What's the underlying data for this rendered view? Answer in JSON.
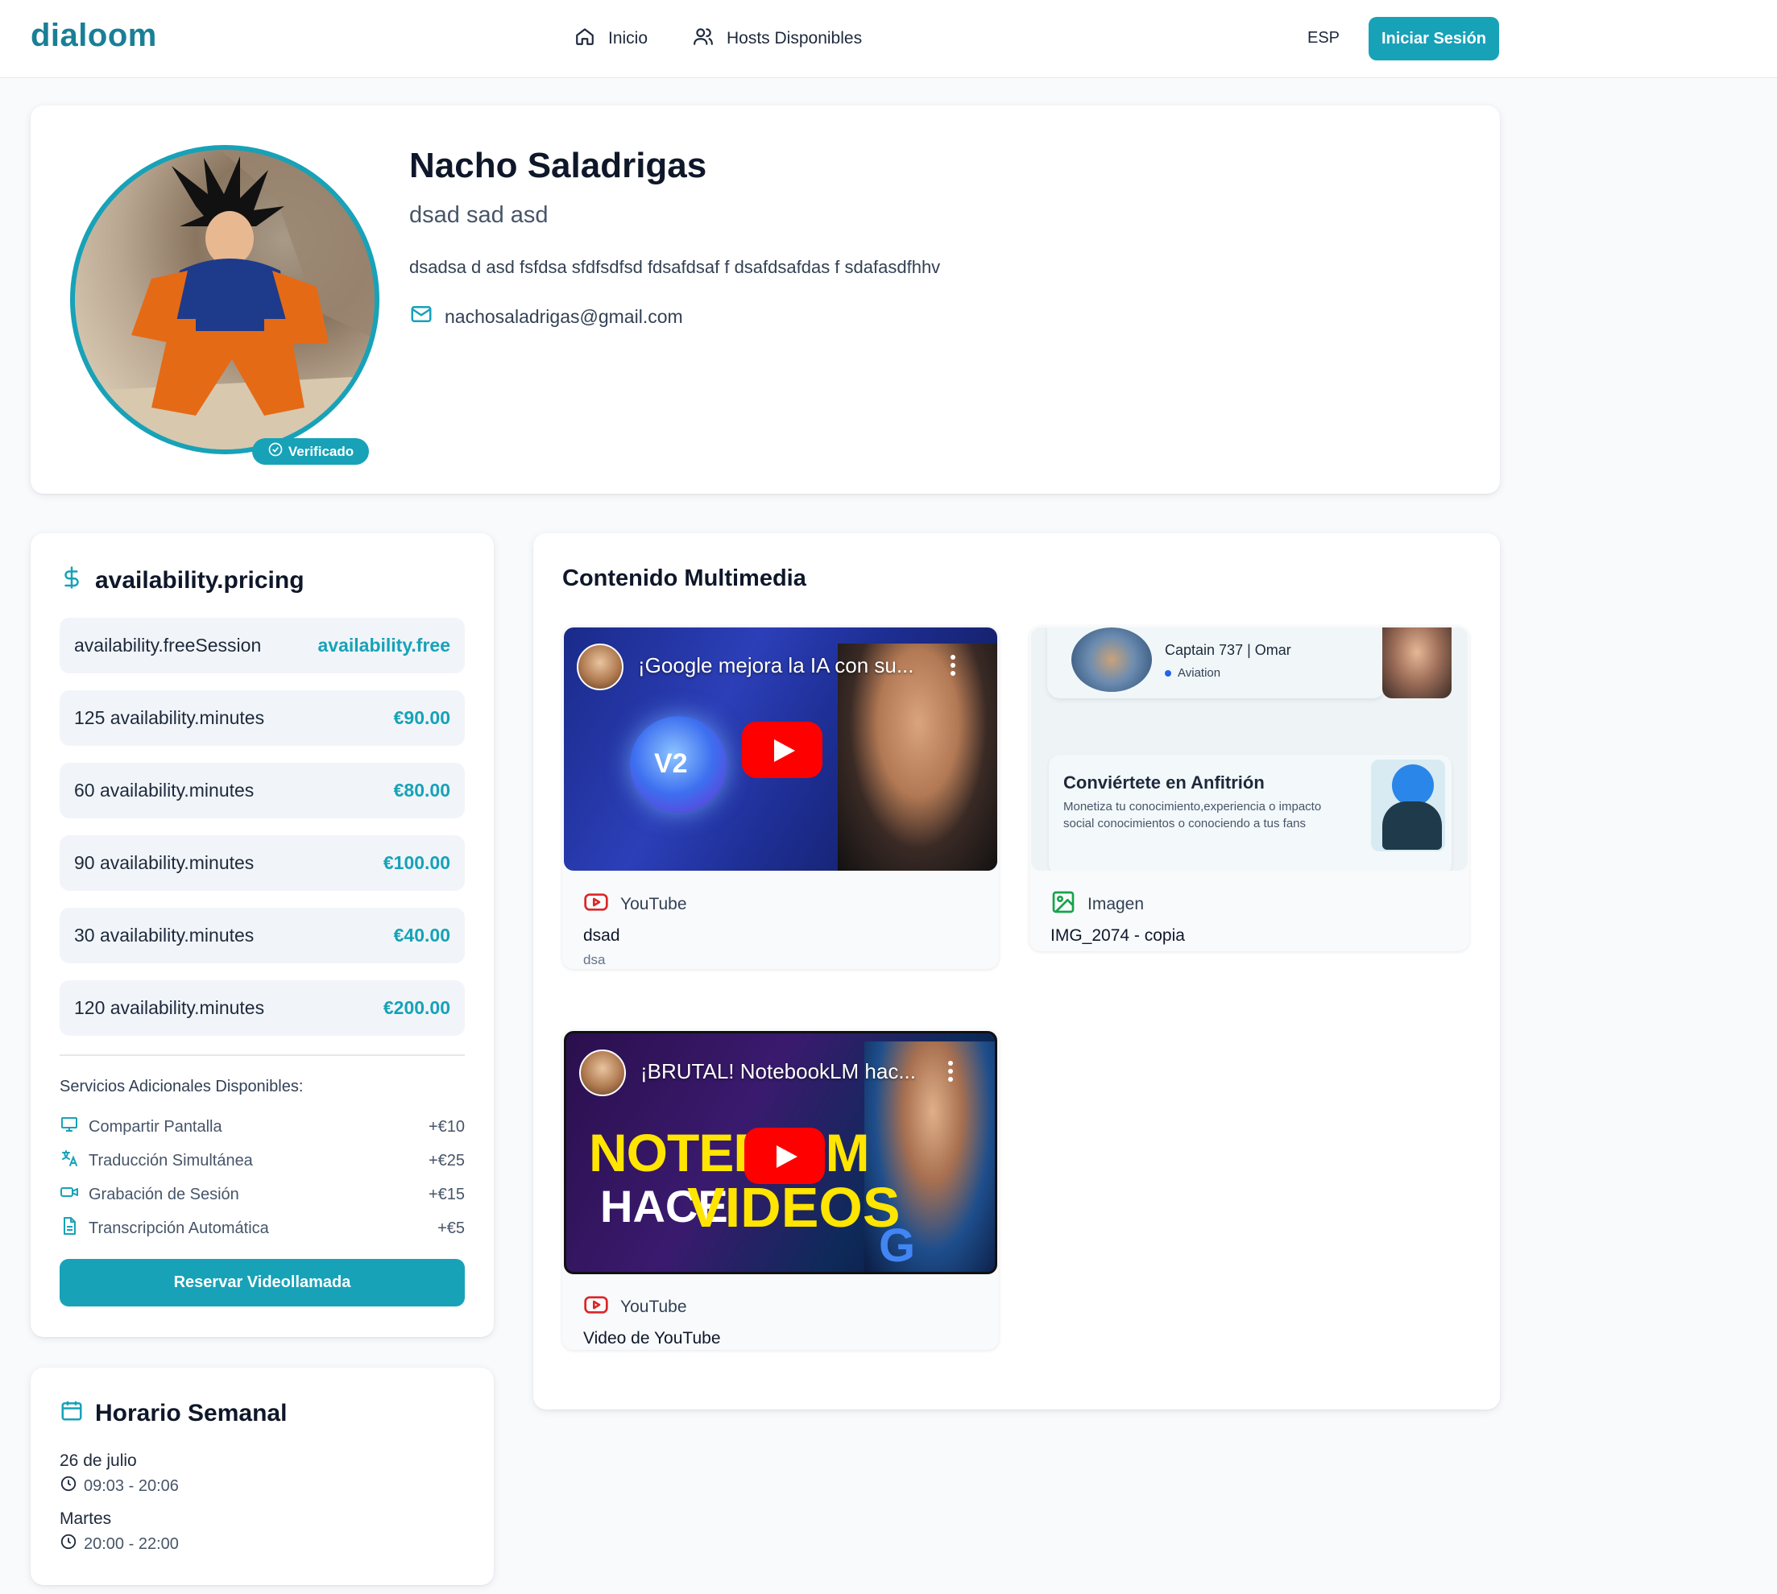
{
  "nav": {
    "logo": "dialoom",
    "links": [
      {
        "label": "Inicio",
        "icon": "home-icon"
      },
      {
        "label": "Hosts Disponibles",
        "icon": "users-icon"
      }
    ],
    "language": "ESP",
    "login_label": "Iniciar Sesión"
  },
  "profile": {
    "name": "Nacho Saladrigas",
    "subtitle": "dsad sad asd",
    "bio": "dsadsa d asd fsfdsa sfdfsdfsd fdsafdsaf f dsafdsafdas f sdafasdfhhv",
    "email": "nachosaladrigas@gmail.com",
    "verified_label": "Verificado"
  },
  "pricing": {
    "title": "availability.pricing",
    "rows": [
      {
        "label": "availability.freeSession",
        "value": "availability.free"
      },
      {
        "label": "125 availability.minutes",
        "value": "€90.00"
      },
      {
        "label": "60 availability.minutes",
        "value": "€80.00"
      },
      {
        "label": "90 availability.minutes",
        "value": "€100.00"
      },
      {
        "label": "30 availability.minutes",
        "value": "€40.00"
      },
      {
        "label": "120 availability.minutes",
        "value": "€200.00"
      }
    ],
    "services_title": "Servicios Adicionales Disponibles:",
    "services": [
      {
        "label": "Compartir Pantalla",
        "price": "+€10",
        "icon": "monitor-icon"
      },
      {
        "label": "Traducción Simultánea",
        "price": "+€25",
        "icon": "translate-icon"
      },
      {
        "label": "Grabación de Sesión",
        "price": "+€15",
        "icon": "video-camera-icon"
      },
      {
        "label": "Transcripción Automática",
        "price": "+€5",
        "icon": "document-icon"
      }
    ],
    "reserve_label": "Reservar Videollamada"
  },
  "schedule": {
    "title": "Horario Semanal",
    "entries": [
      {
        "day": "26 de julio",
        "time": "09:03 - 20:06"
      },
      {
        "day": "Martes",
        "time": "20:00 - 22:00"
      }
    ]
  },
  "media": {
    "title": "Contenido Multimedia",
    "items": [
      {
        "source": "YouTube",
        "title": "dsad",
        "description": "dsa",
        "thumb_title": "¡Google mejora la IA con su...",
        "thumb_text": "V2"
      },
      {
        "source": "Imagen",
        "title": "IMG_2074 - copia",
        "img_caption": "Captain 737 | Omar",
        "img_tag": "Aviation",
        "img_host_title": "Conviértete en Anfitrión",
        "img_host_desc": "Monetiza tu conocimiento,experiencia o impacto social conocimientos o conociendo a tus fans"
      },
      {
        "source": "YouTube",
        "title": "Video de YouTube",
        "thumb_title": "¡BRUTAL! NotebookLM hac...",
        "thumb_big": "NOTEBO  M",
        "thumb_hace": "HACE",
        "thumb_videos": "VIDEOS",
        "thumb_logo": "G"
      }
    ]
  },
  "colors": {
    "accent": "#17a2b8",
    "youtube": "#dc2626",
    "image": "#16a34a"
  }
}
